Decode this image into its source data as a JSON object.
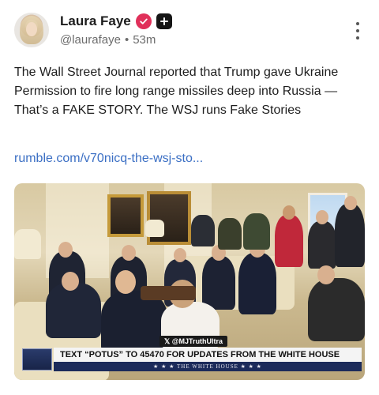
{
  "author": {
    "display_name": "Laura Faye",
    "handle": "@laurafaye",
    "separator": "•",
    "time_ago": "53m",
    "verified_color": "#e0305a",
    "icons": [
      "verified-badge-icon",
      "plus-badge-icon",
      "more-options-icon"
    ]
  },
  "post": {
    "text": "The Wall Street Journal reported that Trump gave Ukraine Permission to fire long range missiles deep into Russia — That’s a FAKE STORY. The WSJ runs Fake Stories",
    "link": "rumble.com/v70nicq-the-wsj-sto..."
  },
  "media": {
    "watermark": "@MJTruthUltra",
    "banner_text": "TEXT “POTUS” TO 45470 FOR UPDATES FROM THE WHITE HOUSE",
    "banner_sub": "★ ★ ★  THE WHITE HOUSE  ★ ★ ★"
  },
  "colors": {
    "link": "#3b6fc4",
    "banner_navy": "#1c2b5a"
  }
}
